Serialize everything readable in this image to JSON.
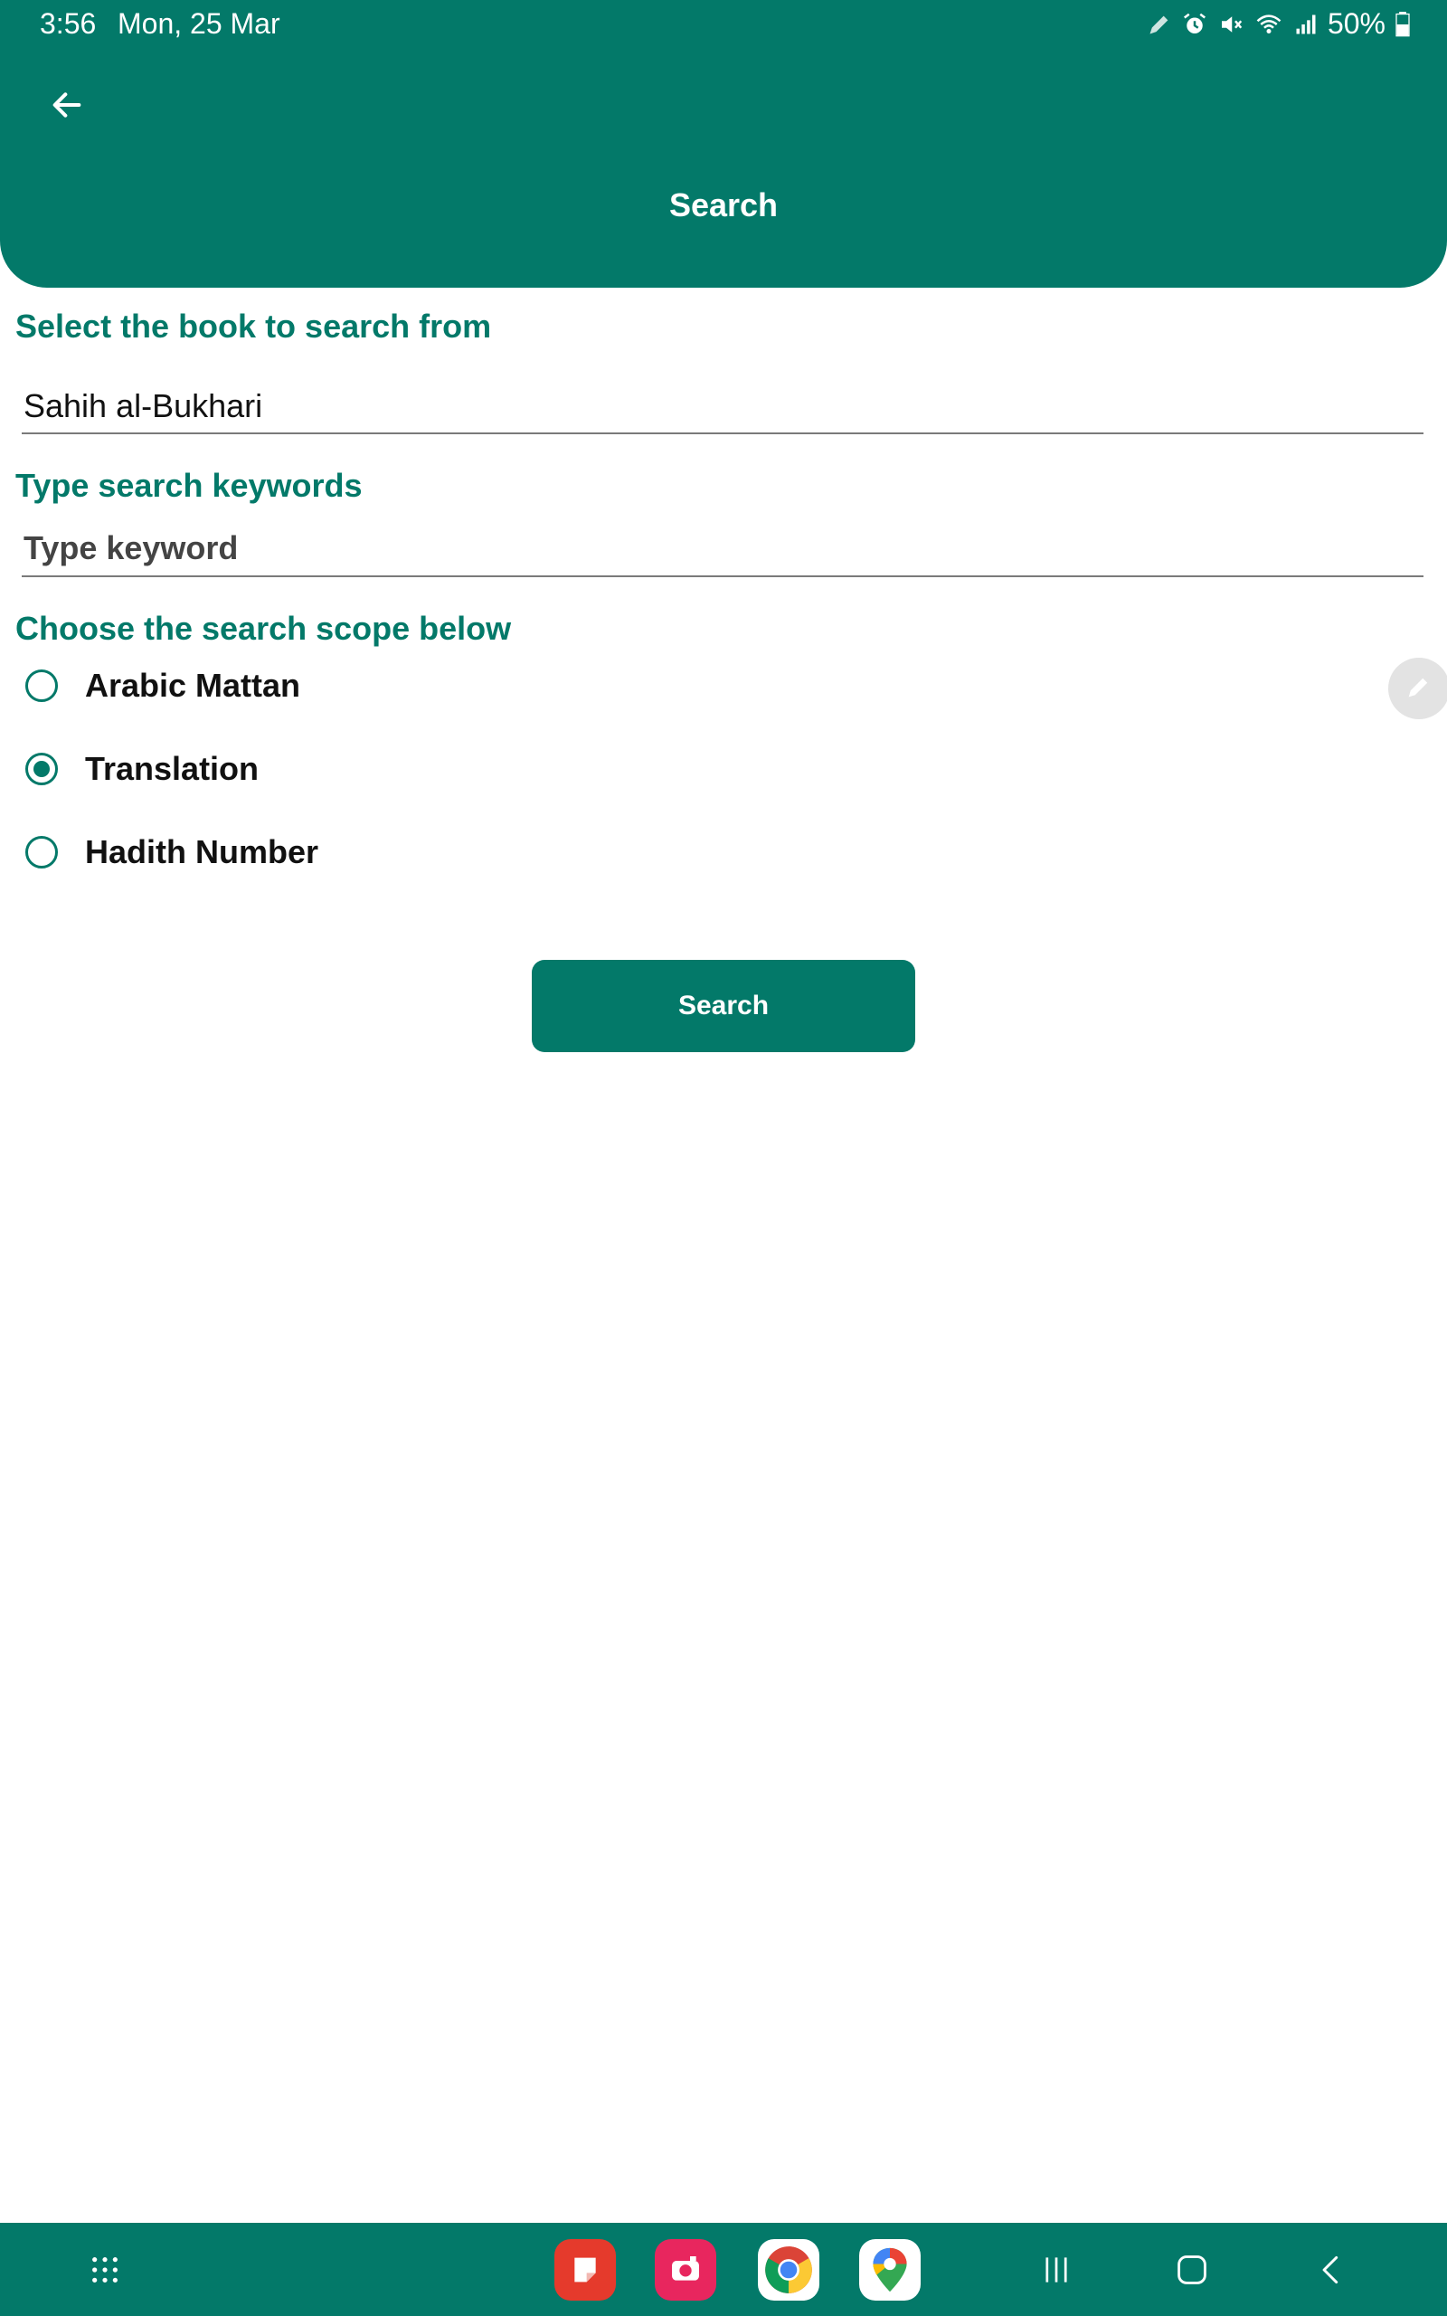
{
  "status_bar": {
    "time": "3:56",
    "date": "Mon, 25 Mar",
    "battery": "50%",
    "icons": [
      "pencil-icon",
      "alarm-icon",
      "mute-icon",
      "wifi-icon",
      "signal-icon",
      "battery-icon"
    ]
  },
  "header": {
    "title": "Search",
    "back_icon": "arrow-left-icon"
  },
  "book_section": {
    "label": "Select the book to search from",
    "selected_book": "Sahih al-Bukhari"
  },
  "keyword_section": {
    "label": "Type search keywords",
    "placeholder": "Type keyword",
    "value": ""
  },
  "scope_section": {
    "label": "Choose the search scope below",
    "options": [
      {
        "label": "Arabic Mattan",
        "selected": false
      },
      {
        "label": "Translation",
        "selected": true
      },
      {
        "label": "Hadith Number",
        "selected": false
      }
    ]
  },
  "search_button": {
    "label": "Search"
  },
  "colors": {
    "primary": "#037969",
    "label": "#037969",
    "text": "#111111"
  },
  "nav_bar": {
    "items": [
      "app-drawer-icon",
      "samsung-notes-icon",
      "camera-icon",
      "chrome-icon",
      "maps-icon",
      "recents-icon",
      "home-icon",
      "back-icon"
    ]
  }
}
